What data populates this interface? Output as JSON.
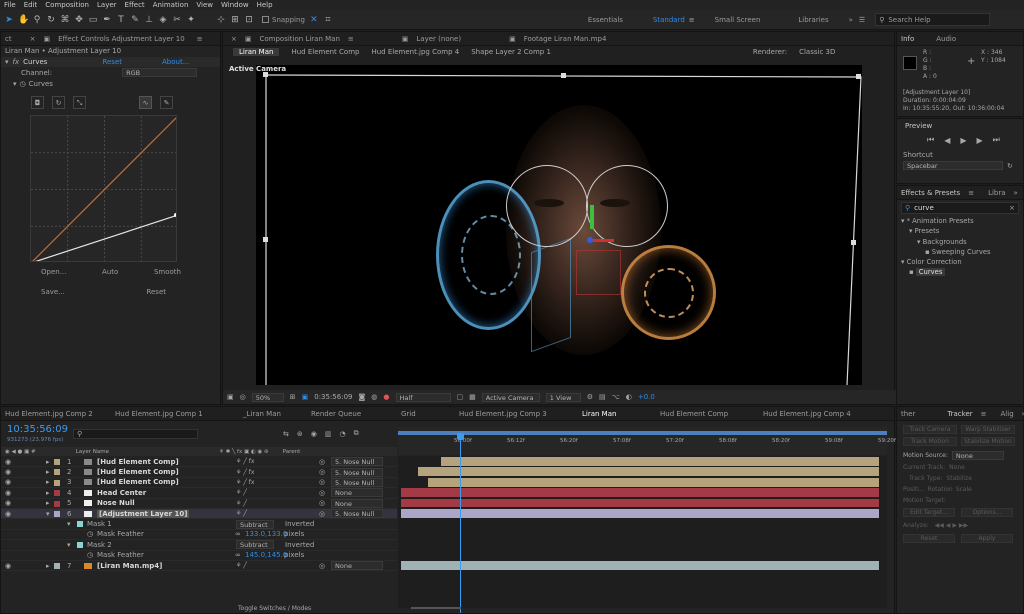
{
  "menu": [
    "File",
    "Edit",
    "Composition",
    "Layer",
    "Effect",
    "Animation",
    "View",
    "Window",
    "Help"
  ],
  "toolbar": {
    "snapping": "Snapping",
    "workspaces": [
      "Essentials",
      "Standard",
      "Small Screen",
      "Libraries"
    ],
    "search_placeholder": "Search Help"
  },
  "effect_controls": {
    "tab_prefix": "ct",
    "tab_title": "Effect Controls",
    "tab_layer": "Adjustment Layer 10",
    "breadcrumb": "Liran Man • Adjustment Layer 10",
    "effect": "Curves",
    "reset": "Reset",
    "about": "About...",
    "channel_label": "Channel:",
    "channel_value": "RGB",
    "curves_label": "Curves",
    "buttons": [
      "Open...",
      "Auto",
      "Smooth",
      "Save...",
      "Reset"
    ]
  },
  "composition": {
    "tab_title": "Composition",
    "tab_name": "Liran Man",
    "layer_tab": "Layer (none)",
    "footage_tab": "Footage Liran Man.mp4",
    "sub_tabs": [
      "Liran Man",
      "Hud Element Comp",
      "Hud Element.jpg Comp 4",
      "Shape Layer 2 Comp 1"
    ],
    "renderer_label": "Renderer:",
    "renderer_value": "Classic 3D",
    "active_camera": "Active Camera",
    "footer": {
      "zoom": "50%",
      "timecode": "0:35:56:09",
      "quality": "Half",
      "camera": "Active Camera",
      "views": "1 View",
      "exposure": "+0.0"
    }
  },
  "info": {
    "tabs": [
      "Info",
      "Audio"
    ],
    "r": "R :",
    "g": "G :",
    "b": "B :",
    "a": "A : 0",
    "x": "X : 346",
    "y": "Y : 1084",
    "line1": "[Adjustment Layer 10]",
    "line2": "Duration: 0:00:04:09",
    "line3": "In: 10:35:55:20, Out: 10:36:00:04"
  },
  "preview": {
    "title": "Preview",
    "shortcut_label": "Shortcut",
    "shortcut_value": "Spacebar"
  },
  "effects_presets": {
    "tab": "Effects & Presets",
    "tab2": "Libra",
    "search": "curve",
    "tree": [
      {
        "label": "* Animation Presets",
        "level": 0
      },
      {
        "label": "Presets",
        "level": 1
      },
      {
        "label": "Backgrounds",
        "level": 2
      },
      {
        "label": "Sweeping Curves",
        "level": 3
      },
      {
        "label": "Color Correction",
        "level": 0
      },
      {
        "label": "Curves",
        "level": 1
      }
    ]
  },
  "timeline": {
    "tabs": [
      "Hud Element.jpg Comp 2",
      "Hud Element.jpg Comp 1",
      "_Liran Man",
      "Render Queue",
      "Grid",
      "Hud Element.jpg Comp 3",
      "Liran Man",
      "Hud Element Comp",
      "Hud Element.jpg Comp 4"
    ],
    "timecode": "10:35:56:09",
    "frame": "931273 (23.976 fps)",
    "col_layer_name": "Layer Name",
    "col_parent": "Parent",
    "ruler": [
      "56:00f",
      "56:12f",
      "56:20f",
      "57:08f",
      "57:20f",
      "58:08f",
      "58:20f",
      "59:08f",
      "59:20f"
    ],
    "layers": [
      {
        "num": "1",
        "name": "[Hud Element Comp]",
        "parent": "5. Nose Null",
        "color": "#b5a37e"
      },
      {
        "num": "2",
        "name": "[Hud Element Comp]",
        "parent": "5. Nose Null",
        "color": "#b5a37e"
      },
      {
        "num": "3",
        "name": "[Hud Element Comp]",
        "parent": "5. Nose Null",
        "color": "#b5a37e"
      },
      {
        "num": "4",
        "name": "Head Center",
        "parent": "None",
        "color": "#a33a45"
      },
      {
        "num": "5",
        "name": "Nose Null",
        "parent": "None",
        "color": "#a33a45"
      },
      {
        "num": "6",
        "name": "[Adjustment Layer 10]",
        "parent": "5. Nose Null",
        "color": "#a9a6c8"
      },
      {
        "num": "7",
        "name": "[Liran Man.mp4]",
        "parent": "None",
        "color": "#9fb3b5"
      }
    ],
    "masks": [
      {
        "name": "Mask 1",
        "mode": "Subtract",
        "inverted": "Inverted",
        "feather_label": "Mask Feather",
        "feather_value": "133.0,133.0",
        "unit": "pixels"
      },
      {
        "name": "Mask 2",
        "mode": "Subtract",
        "inverted": "Inverted",
        "feather_label": "Mask Feather",
        "feather_value": "145.0,145.0",
        "unit": "pixels"
      }
    ],
    "toggle": "Toggle Switches / Modes"
  },
  "tracker": {
    "tab_prefix": "ther",
    "tab": "Tracker",
    "tab2": "Alig",
    "buttons": [
      "Track Camera",
      "Warp Stabilizer",
      "Track Motion",
      "Stabilize Motion"
    ],
    "motion_source_label": "Motion Source:",
    "motion_source_value": "None",
    "current_track_label": "Current Track:",
    "current_track_value": "None",
    "track_type_label": "Track Type:",
    "track_type_value": "Stabilize",
    "checks": [
      "Positi...",
      "Rotation",
      "Scale"
    ],
    "motion_target": "Motion Target:",
    "edit_target": "Edit Target...",
    "options": "Options...",
    "analyze": "Analyze:",
    "reset": "Reset",
    "apply": "Apply"
  }
}
